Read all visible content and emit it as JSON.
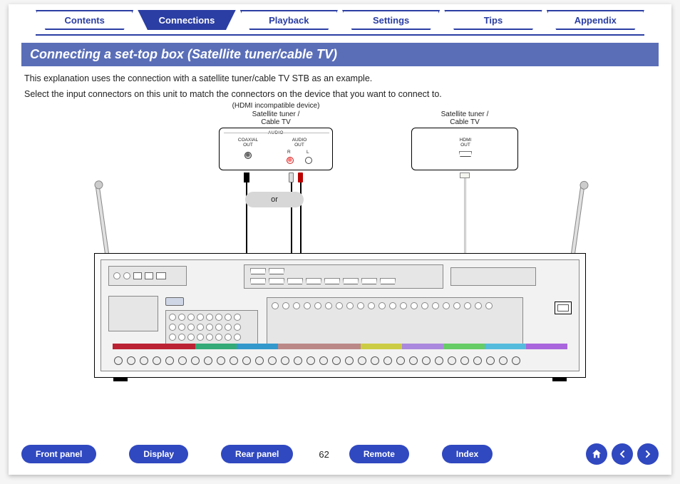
{
  "tabs": [
    {
      "label": "Contents",
      "active": false
    },
    {
      "label": "Connections",
      "active": true
    },
    {
      "label": "Playback",
      "active": false
    },
    {
      "label": "Settings",
      "active": false
    },
    {
      "label": "Tips",
      "active": false
    },
    {
      "label": "Appendix",
      "active": false
    }
  ],
  "heading": "Connecting a set-top box (Satellite tuner/cable TV)",
  "paragraph1": "This explanation uses the connection with a satellite tuner/cable TV STB as an example.",
  "paragraph2": "Select the input connectors on this unit to match the connectors on the device that you want to connect to.",
  "diagram": {
    "hdmi_incompatible_note": "(HDMI incompatible device)",
    "device_left_title_l1": "Satellite tuner /",
    "device_left_title_l2": "Cable TV",
    "device_right_title_l1": "Satellite tuner /",
    "device_right_title_l2": "Cable TV",
    "audio_caption": "AUDIO",
    "coax_out_l1": "COAXIAL",
    "coax_out_l2": "OUT",
    "audio_out_l1": "AUDIO",
    "audio_out_l2": "OUT",
    "rca_r": "R",
    "rca_l": "L",
    "hdmi_out_l1": "HDMI",
    "hdmi_out_l2": "OUT",
    "or_label": "or"
  },
  "footer": {
    "buttons": [
      "Front panel",
      "Display",
      "Rear panel"
    ],
    "buttons_right": [
      "Remote",
      "Index"
    ],
    "page": "62"
  },
  "icons": {
    "home": "home-icon",
    "prev": "arrow-left-icon",
    "next": "arrow-right-icon"
  }
}
